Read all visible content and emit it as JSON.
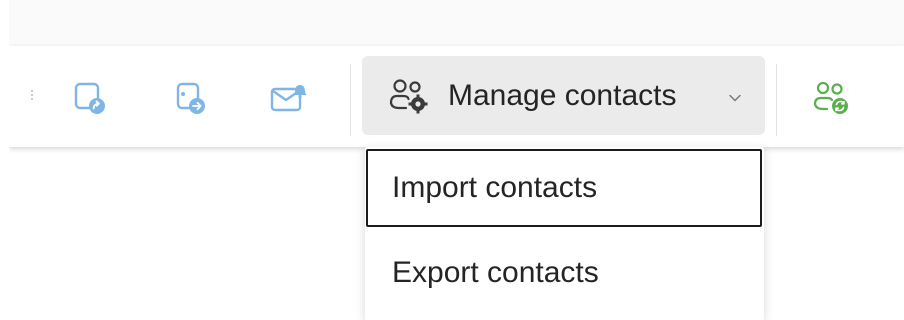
{
  "toolbar": {
    "icons": [
      {
        "name": "share-to-teams-icon",
        "color": "#7fb6e6"
      },
      {
        "name": "forward-contact-icon",
        "color": "#7fb6e6"
      },
      {
        "name": "mail-contact-icon",
        "color": "#7fb6e6"
      },
      {
        "name": "people-sync-icon",
        "color": "#5ab04c"
      }
    ],
    "manage_contacts": {
      "label": "Manage contacts",
      "icon": "people-settings-icon",
      "chevron": "chevron-down-icon"
    }
  },
  "dropdown": {
    "items": [
      {
        "label": "Import contacts",
        "focused": true
      },
      {
        "label": "Export contacts",
        "focused": false
      }
    ]
  },
  "colors": {
    "accent_blue": "#7fb6e6",
    "accent_green": "#5ab04c",
    "button_bg": "#ebebeb",
    "text": "#242424"
  }
}
